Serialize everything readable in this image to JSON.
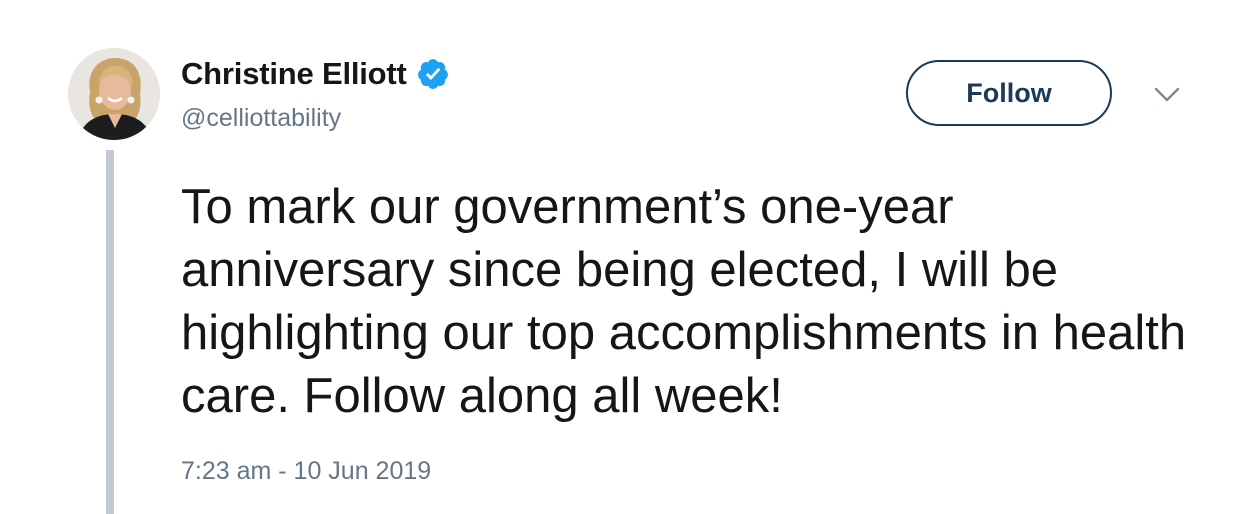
{
  "author": {
    "display_name": "Christine Elliott",
    "handle": "@celliottability",
    "verified": true,
    "verified_icon": "verified-badge-icon"
  },
  "actions": {
    "follow_label": "Follow",
    "more_icon": "chevron-down-icon"
  },
  "tweet": {
    "text": "To mark our government’s one-year anniversary since being elected, I will be highlighting our top accomplishments in health care. Follow along all week!",
    "timestamp": "7:23 am - 10 Jun 2019"
  },
  "colors": {
    "text_primary": "#14171a",
    "text_secondary": "#657786",
    "verified_blue": "#1da1f2",
    "follow_border": "#1c3a5a",
    "thread_line": "#c2cbd5"
  }
}
